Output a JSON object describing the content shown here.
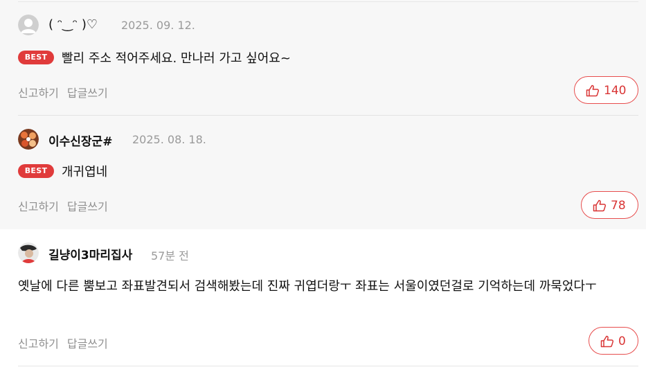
{
  "comments": [
    {
      "author": "( ᵔ‿ᵔ )♡",
      "date": "2025. 09. 12.",
      "best_label": "BEST",
      "text": "빨리 주소 적어주세요. 만나러 가고 싶어요~",
      "report_label": "신고하기",
      "reply_label": "답글쓰기",
      "likes": "140"
    },
    {
      "author": "이수신장군#",
      "date": "2025. 08. 18.",
      "best_label": "BEST",
      "text": "개귀엽네",
      "report_label": "신고하기",
      "reply_label": "답글쓰기",
      "likes": "78"
    },
    {
      "author": "길냥이3마리집사",
      "date": "57분 전",
      "text": " 옛날에 다른 뿜보고 좌표발견되서 검색해봤는데 진짜 귀엽더랑ㅜ 좌표는 서울이였던걸로 기억하는데 까묵었다ㅜ",
      "report_label": "신고하기",
      "reply_label": "답글쓰기",
      "likes": "0"
    }
  ],
  "icons": {
    "like": "thumbs-up-icon",
    "default_avatar": "user-silhouette-icon"
  },
  "colors": {
    "accent": "#e03b3b",
    "best_background": "#e03b3b",
    "like_text": "#d93535",
    "muted_text": "#8f8f8f",
    "date_text": "#9a9a9a",
    "best_band_background": "#f7f7f7"
  }
}
